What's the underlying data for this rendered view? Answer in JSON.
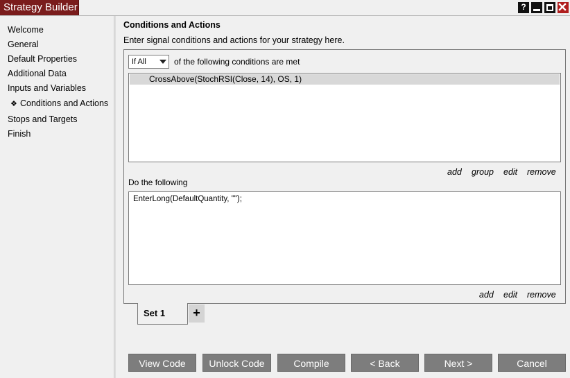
{
  "window": {
    "title": "Strategy Builder",
    "controls": {
      "help": "?"
    }
  },
  "sidebar": {
    "items": [
      {
        "label": "Welcome"
      },
      {
        "label": "General"
      },
      {
        "label": "Default Properties"
      },
      {
        "label": "Additional Data"
      },
      {
        "label": "Inputs and Variables"
      },
      {
        "label": "Conditions and Actions",
        "active": true,
        "bullet": "❖"
      },
      {
        "label": "Stops and Targets"
      },
      {
        "label": "Finish"
      }
    ]
  },
  "main": {
    "heading": "Conditions and Actions",
    "description": "Enter signal conditions and actions for your strategy here.",
    "conditions": {
      "match_select": "If All",
      "match_label": "of the following conditions are met",
      "items": [
        "CrossAbove(StochRSI(Close, 14), OS, 1)"
      ],
      "links": {
        "add": "add",
        "group": "group",
        "edit": "edit",
        "remove": "remove"
      }
    },
    "actions": {
      "label": "Do the following",
      "text": "EnterLong(DefaultQuantity, \"\");",
      "links": {
        "add": "add",
        "edit": "edit",
        "remove": "remove"
      }
    },
    "sets": {
      "tab": "Set 1",
      "add": "+"
    }
  },
  "footer": {
    "view_code": "View Code",
    "unlock_code": "Unlock Code",
    "compile": "Compile",
    "back": "< Back",
    "next": "Next >",
    "cancel": "Cancel"
  },
  "colors": {
    "accent": "#7a1c1c",
    "close": "#b01e1e",
    "button": "#7d7d7d"
  }
}
